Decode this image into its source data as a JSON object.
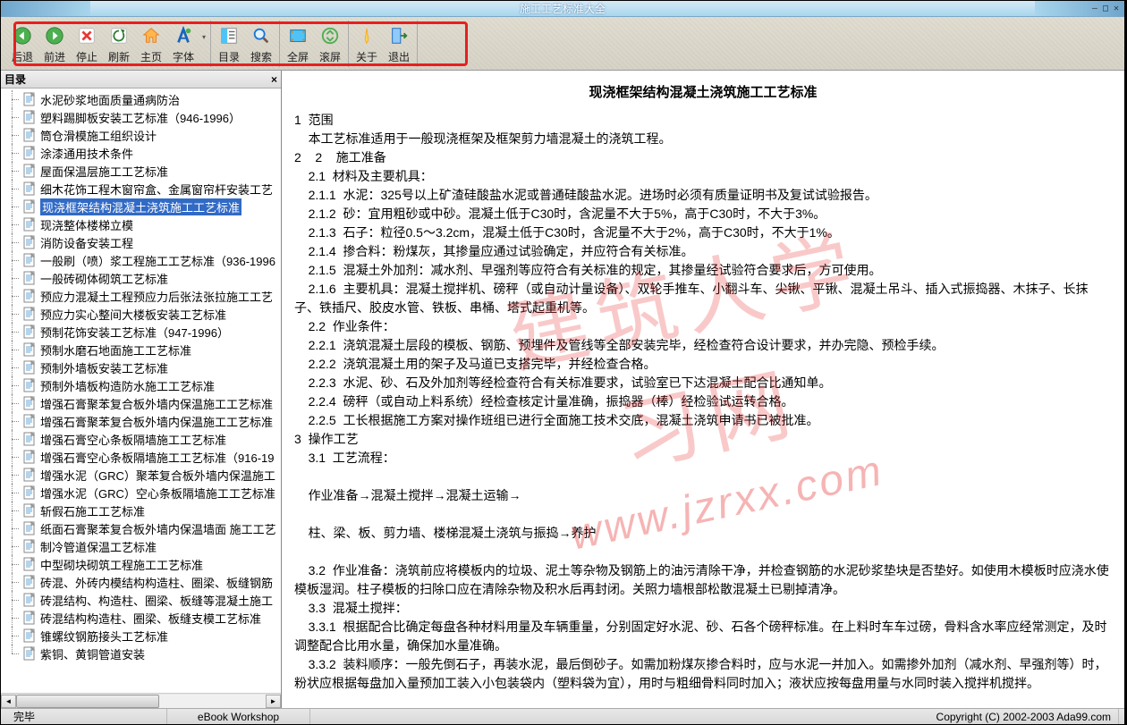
{
  "window": {
    "title": "施工工艺标准大全"
  },
  "toolbar": {
    "groups": [
      {
        "items": [
          {
            "id": "back-button",
            "icon": "arrow-left-green",
            "label": "后退"
          },
          {
            "id": "forward-button",
            "icon": "arrow-right-green",
            "label": "前进"
          },
          {
            "id": "stop-button",
            "icon": "x-red",
            "label": "停止"
          },
          {
            "id": "refresh-button",
            "icon": "refresh",
            "label": "刷新"
          },
          {
            "id": "home-button",
            "icon": "home",
            "label": "主页"
          },
          {
            "id": "font-button",
            "icon": "font",
            "label": "字体",
            "dropdown": true
          }
        ]
      },
      {
        "items": [
          {
            "id": "toc-button",
            "icon": "toc",
            "label": "目录"
          },
          {
            "id": "search-button",
            "icon": "search",
            "label": "搜索"
          }
        ]
      },
      {
        "items": [
          {
            "id": "fullscreen-button",
            "icon": "fullscreen",
            "label": "全屏"
          },
          {
            "id": "scroll-button",
            "icon": "scroll",
            "label": "滚屏"
          }
        ]
      },
      {
        "items": [
          {
            "id": "about-button",
            "icon": "about",
            "label": "关于"
          },
          {
            "id": "exit-button",
            "icon": "exit",
            "label": "退出"
          }
        ]
      }
    ]
  },
  "sidebar": {
    "title": "目录",
    "items": [
      "水泥砂浆地面质量通病防治",
      "塑料踢脚板安装工艺标准（946-1996）",
      "筒仓滑模施工组织设计",
      "涂漆通用技术条件",
      "屋面保温层施工工艺标准",
      "细木花饰工程木窗帘盒、金属窗帘杆安装工艺",
      "现浇框架结构混凝土浇筑施工工艺标准",
      "现浇整体楼梯立模",
      "消防设备安装工程",
      "一般刷（喷）浆工程施工工艺标准（936-1996",
      "一般砖砌体砌筑工艺标准",
      "预应力混凝土工程预应力后张法张拉施工工艺",
      "预应力实心整间大楼板安装工艺标准",
      "预制花饰安装工艺标准（947-1996）",
      "预制水磨石地面施工工艺标准",
      "预制外墙板安装工艺标准",
      "预制外墙板构造防水施工工艺标准",
      "增强石膏聚苯复合板外墙内保温施工工艺标准",
      "增强石膏聚苯复合板外墙内保温施工工艺标准",
      "增强石膏空心条板隔墙施工工艺标准",
      "增强石膏空心条板隔墙施工工艺标准（916-19",
      "增强水泥（GRC）聚苯复合板外墙内保温施工",
      "增强水泥（GRC）空心条板隔墙施工工艺标准",
      "斩假石施工工艺标准",
      "纸面石膏聚苯复合板外墙内保温墙面 施工工艺",
      "制冷管道保温工艺标准",
      "中型砌块砌筑工程施工工艺标准",
      "砖混、外砖内模结构构造柱、圈梁、板缝钢筋",
      "砖混结构、构造柱、圈梁、板缝等混凝土施工",
      "砖混结构构造柱、圈梁、板缝支模工艺标准",
      "锥螺纹钢筋接头工艺标准",
      "紫铜、黄铜管道安装"
    ],
    "selected_index": 6
  },
  "content": {
    "title": "现浇框架结构混凝土浇筑施工工艺标准",
    "body": [
      "1  范围",
      "    本工艺标准适用于一般现浇框架及框架剪力墙混凝土的浇筑工程。",
      "2    2    施工准备",
      "    2.1  材料及主要机具：",
      "    2.1.1  水泥：325号以上矿渣硅酸盐水泥或普通硅酸盐水泥。进场时必须有质量证明书及复试试验报告。",
      "    2.1.2  砂：宜用粗砂或中砂。混凝土低于C30时，含泥量不大于5%，高于C30时，不大于3%。",
      "    2.1.3  石子：粒径0.5～3.2cm，混凝土低于C30时，含泥量不大于2%，高于C30时，不大于1%。",
      "    2.1.4  掺合料：粉煤灰，其掺量应通过试验确定，并应符合有关标准。",
      "    2.1.5  混凝土外加剂：减水剂、早强剂等应符合有关标准的规定，其掺量经试验符合要求后，方可使用。",
      "    2.1.6  主要机具：混凝土搅拌机、磅秤（或自动计量设备）、双轮手推车、小翻斗车、尖锹、平锹、混凝土吊斗、插入式振捣器、木抹子、长抹子、铁插尺、胶皮水管、铁板、串桶、塔式起重机等。",
      "    2.2  作业条件：",
      "    2.2.1  浇筑混凝土层段的模板、钢筋、预埋件及管线等全部安装完毕，经检查符合设计要求，并办完隐、预检手续。",
      "    2.2.2  浇筑混凝土用的架子及马道已支搭完毕，并经检查合格。",
      "    2.2.3  水泥、砂、石及外加剂等经检查符合有关标准要求，试验室已下达混凝土配合比通知单。",
      "    2.2.4  磅秤（或自动上料系统）经检查核定计量准确，振捣器（棒）经检验试运转合格。",
      "    2.2.5  工长根据施工方案对操作班组已进行全面施工技术交底，混凝土浇筑申请书已被批准。",
      "3  操作工艺",
      "    3.1  工艺流程：",
      "",
      "    作业准备→混凝土搅拌→混凝土运输→",
      "",
      "    柱、梁、板、剪力墙、楼梯混凝土浇筑与振捣→养护",
      "",
      "    3.2  作业准备：浇筑前应将模板内的垃圾、泥土等杂物及钢筋上的油污清除干净，并检查钢筋的水泥砂浆垫块是否垫好。如使用木模板时应浇水使模板湿润。柱子模板的扫除口应在清除杂物及积水后再封闭。关照力墙根部松散混凝土已剔掉清净。",
      "    3.3  混凝土搅拌：",
      "    3.3.1  根据配合比确定每盘各种材料用量及车辆重量，分别固定好水泥、砂、石各个磅秤标准。在上料时车车过磅，骨料含水率应经常测定，及时调整配合比用水量，确保加水量准确。",
      "    3.3.2  装料顺序：一般先倒石子，再装水泥，最后倒砂子。如需加粉煤灰掺合料时，应与水泥一并加入。如需掺外加剂（减水剂、早强剂等）时，粉状应根据每盘加入量预加工装入小包装袋内（塑料袋为宜），用时与粗细骨料同时加入；液状应按每盘用量与水同时装入搅拌机搅拌。"
    ]
  },
  "watermark": {
    "line1": "建筑人学习网",
    "line2": "www.jzrxx.com"
  },
  "status": {
    "left": "完毕",
    "center": "eBook Workshop",
    "right": "Copyright (C) 2002-2003 Ada99.com"
  }
}
